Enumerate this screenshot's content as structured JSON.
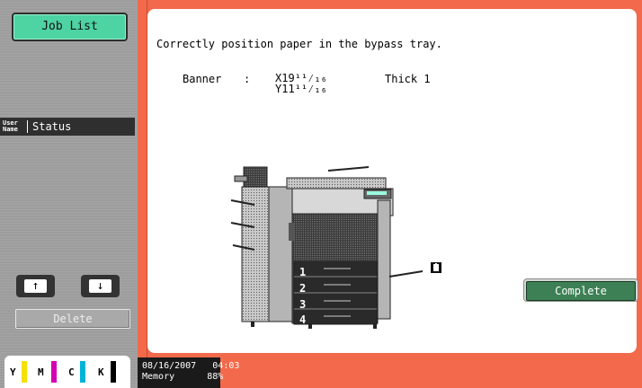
{
  "sidebar": {
    "job_list_label": "Job List",
    "header": {
      "user_name": "User Name",
      "status": "Status"
    },
    "scroll_up": "↑",
    "scroll_down": "↓",
    "delete_label": "Delete",
    "toner": [
      {
        "letter": "Y",
        "color": "#f5e000"
      },
      {
        "letter": "M",
        "color": "#d400b4"
      },
      {
        "letter": "C",
        "color": "#00b4d8"
      },
      {
        "letter": "K",
        "color": "#000000"
      }
    ]
  },
  "main": {
    "message": "Correctly position paper in the bypass tray.",
    "paper_size_label": "Banner",
    "separator": ":",
    "dimension_x": "X19¹¹⁄₁₆",
    "dimension_y": "Y11¹¹⁄₁₆",
    "paper_type": "Thick 1",
    "tray_numbers": [
      "1",
      "2",
      "3",
      "4"
    ],
    "complete_label": "Complete"
  },
  "status_bar": {
    "date": "08/16/2007",
    "time": "04:03",
    "memory_label": "Memory",
    "memory_value": "88%"
  },
  "colors": {
    "frame": "#f26a4b",
    "job_list": "#4ed3a3",
    "complete": "#3d8055"
  }
}
